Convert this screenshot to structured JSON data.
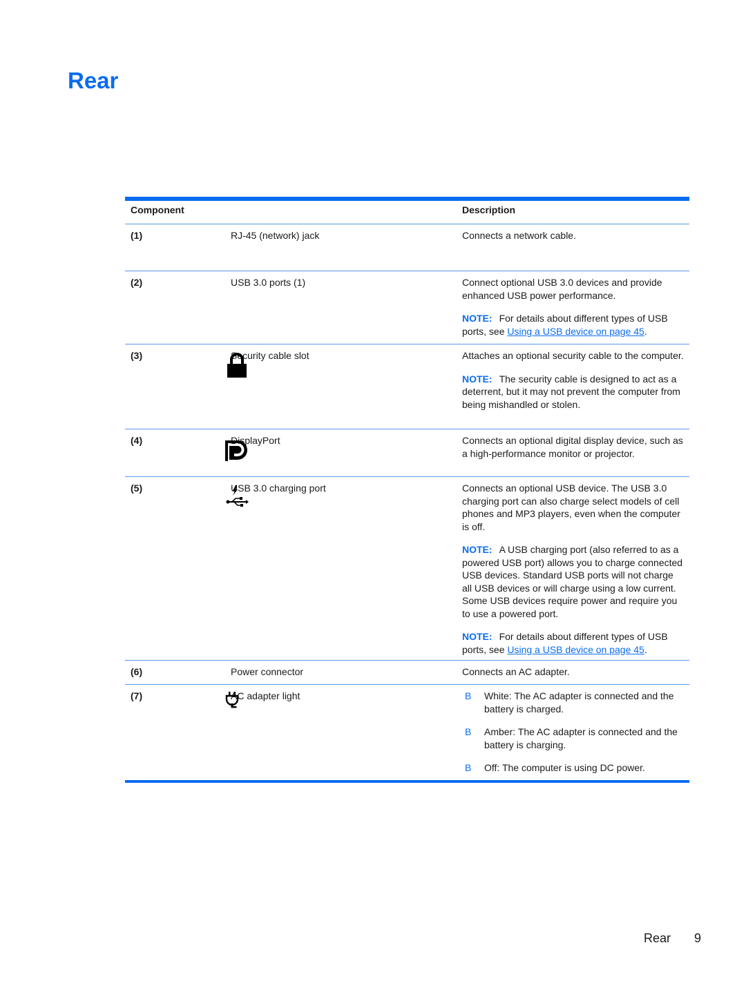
{
  "page": {
    "title": "Rear",
    "footer_section": "Rear",
    "footer_page_number": "9"
  },
  "colors": {
    "accent": "#0a6cf0",
    "row_rule": "#5a94ee",
    "text": "#1a1a1a"
  },
  "table": {
    "headers": {
      "component": "Component",
      "description": "Description"
    },
    "rows": [
      {
        "num": "(1)",
        "icon": "",
        "name": "RJ-45 (network) jack",
        "desc": "Connects a network cable."
      },
      {
        "num": "(2)",
        "icon": "",
        "name": "USB 3.0 ports (1)",
        "desc": "Connect optional USB 3.0 devices and provide enhanced USB power performance.",
        "note_label": "NOTE:",
        "note_text": "For details about different types of USB ports, see ",
        "note_link": "Using a USB device on page 45",
        "note_end": "."
      },
      {
        "num": "(3)",
        "icon": "lock-icon",
        "name": "Security cable slot",
        "desc": "Attaches an optional security cable to the computer.",
        "note_label": "NOTE:",
        "note_text": "The security cable is designed to act as a deterrent, but it may not prevent the computer from being mishandled or stolen."
      },
      {
        "num": "(4)",
        "icon": "displayport-icon",
        "name": "DisplayPort",
        "desc": "Connects an optional digital display device, such as a high-performance monitor or projector."
      },
      {
        "num": "(5)",
        "icon": "usb-charging-icon",
        "name": "USB 3.0 charging port",
        "desc": "Connects an optional USB device. The USB 3.0 charging port can also charge select models of cell phones and MP3 players, even when the computer is off.",
        "note1_label": "NOTE:",
        "note1_text": "A USB charging port (also referred to as a powered USB port) allows you to charge connected USB devices. Standard USB ports will not charge all USB devices or will charge using a low current. Some USB devices require power and require you to use a powered port.",
        "note2_label": "NOTE:",
        "note2_text": "For details about different types of USB ports, see ",
        "note2_link": "Using a USB device on page 45",
        "note2_end": "."
      },
      {
        "num": "(6)",
        "icon": "",
        "name": "Power connector",
        "desc": "Connects an AC adapter."
      },
      {
        "num": "(7)",
        "icon": "plug-icon",
        "name": "AC adapter light",
        "bullets": [
          {
            "mark": "B",
            "text": "White: The AC adapter is connected and the battery is charged."
          },
          {
            "mark": "B",
            "text": "Amber: The AC adapter is connected and the battery is charging."
          },
          {
            "mark": "B",
            "text": "Off: The computer is using DC power."
          }
        ]
      }
    ]
  }
}
